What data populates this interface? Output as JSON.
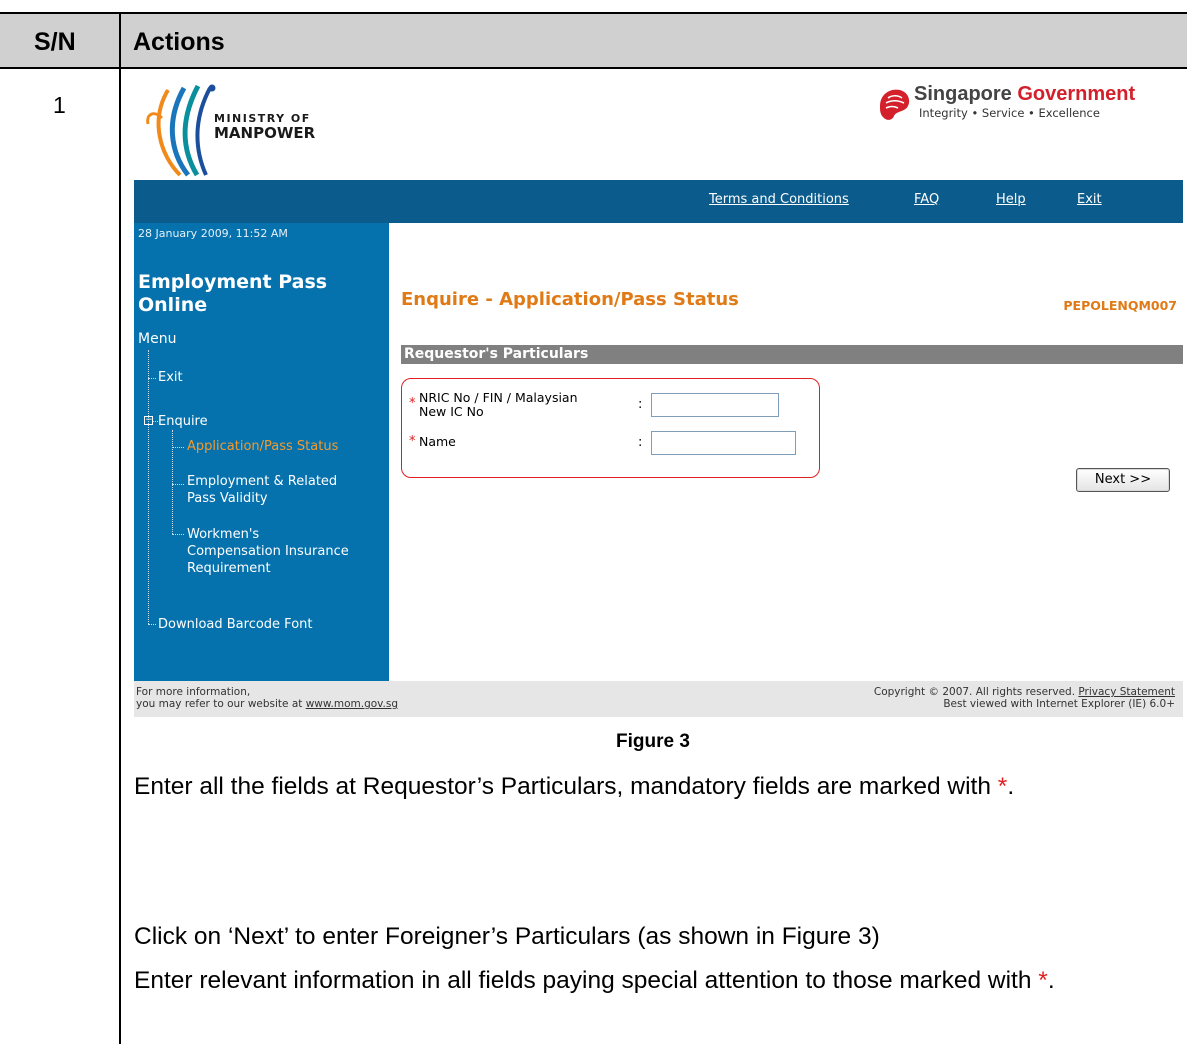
{
  "table": {
    "header_sn": "S/N",
    "header_actions": "Actions",
    "row_number": "1"
  },
  "screenshot": {
    "mom_logo": {
      "line1": "MINISTRY OF",
      "line2": "MANPOWER"
    },
    "sg_logo": {
      "name_part1": "Singapore",
      "name_part2": "Government",
      "motto": "Integrity • Service • Excellence"
    },
    "topnav": {
      "terms": "Terms and Conditions",
      "faq": "FAQ",
      "help": "Help",
      "exit": "Exit"
    },
    "sidebar": {
      "datetime": "28 January 2009, 11:52 AM",
      "title_line1": "Employment Pass",
      "title_line2": "Online",
      "menu_label": "Menu",
      "item_exit": "Exit",
      "item_enquire": "Enquire",
      "sub_application": "Application/Pass Status",
      "sub_employment_1": "Employment & Related",
      "sub_employment_2": "Pass Validity",
      "sub_workmen_1": "Workmen's",
      "sub_workmen_2": "Compensation Insurance",
      "sub_workmen_3": "Requirement",
      "item_download": "Download Barcode Font"
    },
    "content": {
      "page_title": "Enquire - Application/Pass Status",
      "page_code": "PEPOLENQM007",
      "section_title": "Requestor's Particulars",
      "field_nric_label_1": "NRIC No / FIN / Malaysian",
      "field_nric_label_2": "New IC No",
      "field_name_label": "Name",
      "required_marker": "*",
      "colon": ":",
      "next_button": "Next >>",
      "nric_value": "",
      "name_value": ""
    },
    "footer": {
      "left_line1": "For more information,",
      "left_line2_prefix": "you may refer to our website at ",
      "left_link": "www.mom.gov.sg",
      "right_line1_prefix": "Copyright © 2007. All rights reserved. ",
      "right_link": "Privacy Statement",
      "right_line2": "Best viewed with Internet Explorer (IE) 6.0+"
    }
  },
  "caption": "Figure 3",
  "instructions": {
    "p1_text": "Enter all the fields at Requestor’s Particulars, mandatory fields are marked with ",
    "p1_star": "*",
    "p1_end": ".",
    "p2": "Click on ‘Next’ to enter Foreigner’s Particulars (as shown in Figure 3)",
    "p3_text": "Enter relevant information in all fields paying special attention to those marked with ",
    "p3_star": "*",
    "p3_end": "."
  },
  "colors": {
    "nav_bar": "#0b5b8c",
    "sidebar": "#0572ae",
    "accent_orange": "#e07a16",
    "required_red": "#e02020",
    "header_gray": "#d0d0d0"
  }
}
